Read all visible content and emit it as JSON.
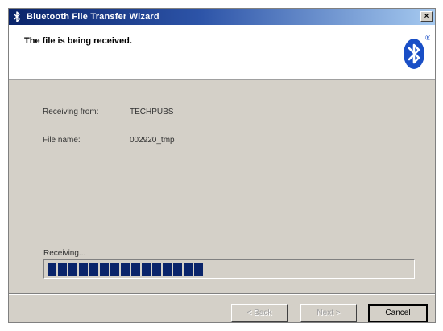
{
  "window": {
    "title": "Bluetooth File Transfer Wizard",
    "close_label": "×"
  },
  "header": {
    "title": "The file is being received.",
    "logo_icon": "bluetooth-logo"
  },
  "fields": {
    "receiving_from_label": "Receiving from:",
    "receiving_from_value": "TECHPUBS",
    "file_name_label": "File name:",
    "file_name_value": "002920_tmp"
  },
  "progress": {
    "label": "Receiving...",
    "fraction": 0.43,
    "color": "#0a246a"
  },
  "buttons": {
    "back_label": "< Back",
    "next_label": "Next >",
    "cancel_label": "Cancel"
  },
  "colors": {
    "title_start": "#0a246a",
    "dialog_bg": "#d4d0c8",
    "bluetooth_blue": "#1a4fc6"
  }
}
